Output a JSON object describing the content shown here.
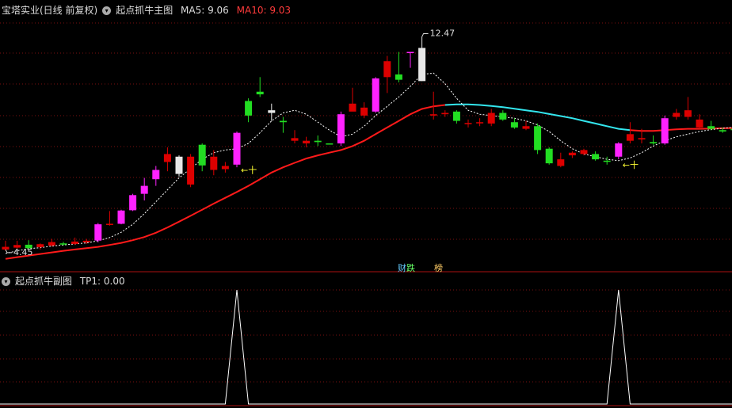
{
  "main_header": {
    "stock": "宝塔实业(日线 前复权)",
    "indicator": "起点抓牛主图",
    "ma5_label": "MA5: 9.06",
    "ma10_label": "MA10: 9.03"
  },
  "sub_header": {
    "indicator": "起点抓牛副图",
    "tp1_label": "TP1: 0.00"
  },
  "bottom_tags": {
    "tag1": "财",
    "tag2": "跌",
    "tag3": "榜"
  },
  "markers": {
    "cross": "十",
    "left_arrow": "←",
    "high_label": "12.47",
    "low_label": "4.45"
  },
  "colors": {
    "up_magenta": "#ff22ff",
    "down_red": "#dd0000",
    "green": "#22dd22",
    "white": "#e8e8e8",
    "ma_red": "#ff1a1a",
    "ma_cyan": "#33e6ee",
    "grid": "#7a1010",
    "dashed": "#ffffff",
    "marker_yellow": "#ffff33"
  },
  "chart_data": [
    {
      "type": "candlestick",
      "title": "起点抓牛主图",
      "ylim": [
        4.0,
        13.2
      ],
      "candles": [
        {
          "o": 4.55,
          "h": 4.78,
          "l": 4.4,
          "c": 4.45,
          "k": "red"
        },
        {
          "o": 4.52,
          "h": 4.78,
          "l": 4.48,
          "c": 4.62,
          "k": "red"
        },
        {
          "o": 4.63,
          "h": 4.8,
          "l": 4.48,
          "c": 4.5,
          "k": "green"
        },
        {
          "o": 4.54,
          "h": 4.68,
          "l": 4.45,
          "c": 4.65,
          "k": "red"
        },
        {
          "o": 4.6,
          "h": 4.85,
          "l": 4.56,
          "c": 4.73,
          "k": "red"
        },
        {
          "o": 4.68,
          "h": 4.74,
          "l": 4.6,
          "c": 4.64,
          "k": "green"
        },
        {
          "o": 4.66,
          "h": 4.9,
          "l": 4.62,
          "c": 4.75,
          "k": "red"
        },
        {
          "o": 4.72,
          "h": 4.85,
          "l": 4.66,
          "c": 4.78,
          "k": "red"
        },
        {
          "o": 4.79,
          "h": 5.45,
          "l": 4.72,
          "c": 5.4,
          "k": "magenta"
        },
        {
          "o": 5.38,
          "h": 5.9,
          "l": 5.35,
          "c": 5.42,
          "k": "red"
        },
        {
          "o": 5.42,
          "h": 5.95,
          "l": 5.4,
          "c": 5.92,
          "k": "magenta"
        },
        {
          "o": 5.93,
          "h": 6.55,
          "l": 5.9,
          "c": 6.5,
          "k": "magenta"
        },
        {
          "o": 6.55,
          "h": 7.15,
          "l": 6.3,
          "c": 6.85,
          "k": "magenta"
        },
        {
          "o": 7.1,
          "h": 7.6,
          "l": 6.85,
          "c": 7.45,
          "k": "magenta"
        },
        {
          "o": 7.75,
          "h": 8.3,
          "l": 7.4,
          "c": 8.05,
          "k": "red"
        },
        {
          "o": 7.3,
          "h": 8.0,
          "l": 7.2,
          "c": 7.95,
          "k": "white"
        },
        {
          "o": 7.95,
          "h": 8.05,
          "l": 6.8,
          "c": 6.9,
          "k": "red"
        },
        {
          "o": 7.62,
          "h": 8.45,
          "l": 7.4,
          "c": 8.4,
          "k": "green"
        },
        {
          "o": 7.95,
          "h": 8.2,
          "l": 7.25,
          "c": 7.45,
          "k": "red"
        },
        {
          "o": 7.48,
          "h": 7.75,
          "l": 7.35,
          "c": 7.6,
          "k": "red"
        },
        {
          "o": 7.65,
          "h": 8.9,
          "l": 7.55,
          "c": 8.85,
          "k": "magenta"
        },
        {
          "o": 9.5,
          "h": 10.15,
          "l": 9.25,
          "c": 10.05,
          "k": "green"
        },
        {
          "o": 10.4,
          "h": 10.95,
          "l": 10.2,
          "c": 10.3,
          "k": "green"
        },
        {
          "o": 9.7,
          "h": 9.95,
          "l": 9.3,
          "c": 9.6,
          "k": "white"
        },
        {
          "o": 9.3,
          "h": 9.45,
          "l": 8.85,
          "c": 9.25,
          "k": "green"
        },
        {
          "o": 8.65,
          "h": 8.95,
          "l": 8.45,
          "c": 8.55,
          "k": "red"
        },
        {
          "o": 8.55,
          "h": 8.7,
          "l": 8.3,
          "c": 8.45,
          "k": "red"
        },
        {
          "o": 8.55,
          "h": 8.75,
          "l": 8.35,
          "c": 8.5,
          "k": "green"
        },
        {
          "o": 8.45,
          "h": 8.45,
          "l": 8.45,
          "c": 8.45,
          "k": "green"
        },
        {
          "o": 8.45,
          "h": 9.65,
          "l": 8.35,
          "c": 9.55,
          "k": "magenta"
        },
        {
          "o": 9.95,
          "h": 10.55,
          "l": 9.8,
          "c": 9.65,
          "k": "red"
        },
        {
          "o": 9.5,
          "h": 10.0,
          "l": 9.4,
          "c": 9.8,
          "k": "red"
        },
        {
          "o": 9.65,
          "h": 10.95,
          "l": 9.6,
          "c": 10.9,
          "k": "magenta"
        },
        {
          "o": 10.95,
          "h": 11.75,
          "l": 10.35,
          "c": 11.55,
          "k": "red"
        },
        {
          "o": 11.05,
          "h": 11.9,
          "l": 10.75,
          "c": 10.85,
          "k": "green"
        },
        {
          "o": 11.88,
          "h": 11.9,
          "l": 11.3,
          "c": 11.9,
          "k": "magenta"
        },
        {
          "o": 12.05,
          "h": 12.47,
          "l": 10.8,
          "c": 10.8,
          "k": "white"
        },
        {
          "o": 9.55,
          "h": 10.4,
          "l": 9.35,
          "c": 9.5,
          "k": "red"
        },
        {
          "o": 9.55,
          "h": 9.7,
          "l": 9.45,
          "c": 9.6,
          "k": "red"
        },
        {
          "o": 9.65,
          "h": 9.7,
          "l": 9.2,
          "c": 9.3,
          "k": "green"
        },
        {
          "o": 9.18,
          "h": 9.35,
          "l": 9.05,
          "c": 9.22,
          "k": "red"
        },
        {
          "o": 9.25,
          "h": 9.4,
          "l": 9.1,
          "c": 9.25,
          "k": "red"
        },
        {
          "o": 9.6,
          "h": 9.75,
          "l": 9.1,
          "c": 9.2,
          "k": "red"
        },
        {
          "o": 9.6,
          "h": 9.7,
          "l": 9.3,
          "c": 9.35,
          "k": "green"
        },
        {
          "o": 9.25,
          "h": 9.4,
          "l": 9.0,
          "c": 9.05,
          "k": "green"
        },
        {
          "o": 9.1,
          "h": 9.3,
          "l": 8.95,
          "c": 9.0,
          "k": "red"
        },
        {
          "o": 9.1,
          "h": 9.2,
          "l": 8.05,
          "c": 8.2,
          "k": "green"
        },
        {
          "o": 8.25,
          "h": 8.3,
          "l": 7.65,
          "c": 7.7,
          "k": "green"
        },
        {
          "o": 7.85,
          "h": 8.1,
          "l": 7.55,
          "c": 7.6,
          "k": "red"
        },
        {
          "o": 8.0,
          "h": 8.15,
          "l": 7.9,
          "c": 8.1,
          "k": "red"
        },
        {
          "o": 8.2,
          "h": 8.25,
          "l": 8.0,
          "c": 8.05,
          "k": "red"
        },
        {
          "o": 8.05,
          "h": 8.15,
          "l": 7.8,
          "c": 7.85,
          "k": "green"
        },
        {
          "o": 7.8,
          "h": 7.95,
          "l": 7.65,
          "c": 7.8,
          "k": "green"
        },
        {
          "o": 7.95,
          "h": 8.5,
          "l": 7.85,
          "c": 8.45,
          "k": "magenta"
        },
        {
          "o": 8.8,
          "h": 9.25,
          "l": 8.45,
          "c": 8.55,
          "k": "red"
        },
        {
          "o": 8.6,
          "h": 9.0,
          "l": 8.45,
          "c": 8.65,
          "k": "red"
        },
        {
          "o": 8.5,
          "h": 8.75,
          "l": 8.4,
          "c": 8.45,
          "k": "green"
        },
        {
          "o": 8.45,
          "h": 9.5,
          "l": 8.4,
          "c": 9.4,
          "k": "magenta"
        },
        {
          "o": 9.45,
          "h": 9.75,
          "l": 9.35,
          "c": 9.6,
          "k": "red"
        },
        {
          "o": 9.7,
          "h": 10.2,
          "l": 9.35,
          "c": 9.45,
          "k": "red"
        },
        {
          "o": 9.35,
          "h": 9.55,
          "l": 9.0,
          "c": 9.05,
          "k": "red"
        },
        {
          "o": 9.1,
          "h": 9.3,
          "l": 8.95,
          "c": 9.0,
          "k": "green"
        },
        {
          "o": 8.95,
          "h": 9.05,
          "l": 8.85,
          "c": 8.9,
          "k": "green"
        },
        {
          "o": 8.95,
          "h": 9.05,
          "l": 8.85,
          "c": 9.0,
          "k": "green"
        }
      ],
      "ma10": [
        4.1,
        4.16,
        4.22,
        4.28,
        4.34,
        4.4,
        4.45,
        4.5,
        4.55,
        4.62,
        4.7,
        4.8,
        4.92,
        5.08,
        5.28,
        5.5,
        5.72,
        5.95,
        6.18,
        6.4,
        6.62,
        6.85,
        7.1,
        7.35,
        7.55,
        7.72,
        7.88,
        8.0,
        8.1,
        8.2,
        8.35,
        8.55,
        8.8,
        9.05,
        9.3,
        9.55,
        9.75,
        9.85,
        9.9,
        9.92,
        9.92,
        9.9,
        9.86,
        9.82,
        9.76,
        9.7,
        9.64,
        9.56,
        9.48,
        9.4,
        9.3,
        9.2,
        9.1,
        9.0,
        8.95,
        8.92,
        8.92,
        8.95,
        8.98,
        9.0,
        9.0,
        9.01,
        9.02,
        9.03
      ],
      "ma5": [
        4.3,
        4.4,
        4.48,
        4.52,
        4.58,
        4.62,
        4.66,
        4.7,
        4.78,
        4.9,
        5.1,
        5.4,
        5.8,
        6.25,
        6.7,
        7.15,
        7.5,
        7.85,
        8.1,
        8.2,
        8.25,
        8.45,
        8.85,
        9.3,
        9.6,
        9.7,
        9.55,
        9.25,
        8.95,
        8.7,
        8.8,
        9.1,
        9.5,
        9.85,
        10.2,
        10.6,
        11.05,
        11.1,
        10.7,
        10.15,
        9.7,
        9.55,
        9.5,
        9.45,
        9.4,
        9.3,
        9.15,
        8.9,
        8.55,
        8.25,
        8.05,
        7.95,
        7.85,
        7.8,
        7.9,
        8.1,
        8.35,
        8.55,
        8.7,
        8.8,
        8.9,
        8.97,
        9.02,
        9.06
      ],
      "high_label_value": 12.47,
      "low_label_value": 4.45
    },
    {
      "type": "line",
      "title": "起点抓牛副图",
      "series": [
        {
          "name": "TP1",
          "values": [
            0,
            0,
            0,
            0,
            0,
            0,
            0,
            0,
            0,
            0,
            0,
            0,
            0,
            0,
            0,
            0,
            0,
            0,
            0,
            0,
            1,
            0,
            0,
            0,
            0,
            0,
            0,
            0,
            0,
            0,
            0,
            0,
            0,
            0,
            0,
            0,
            0,
            0,
            0,
            0,
            0,
            0,
            0,
            0,
            0,
            0,
            0,
            0,
            0,
            0,
            0,
            0,
            0,
            1,
            0,
            0,
            0,
            0,
            0,
            0,
            0,
            0,
            0,
            0
          ]
        }
      ],
      "ylim": [
        0,
        1
      ]
    }
  ]
}
